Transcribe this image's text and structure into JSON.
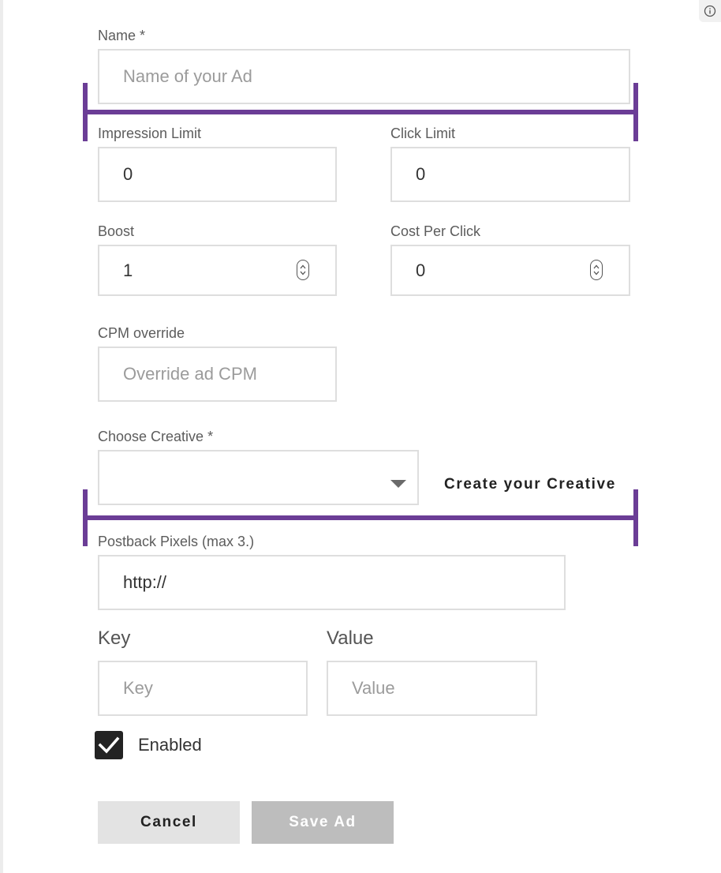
{
  "form": {
    "name": {
      "label": "Name *",
      "placeholder": "Name of your Ad",
      "value": ""
    },
    "impression_limit": {
      "label": "Impression Limit",
      "value": "0"
    },
    "click_limit": {
      "label": "Click Limit",
      "value": "0"
    },
    "boost": {
      "label": "Boost",
      "value": "1"
    },
    "cost_per_click": {
      "label": "Cost Per Click",
      "value": "0"
    },
    "cpm_override": {
      "label": "CPM override",
      "placeholder": "Override ad CPM",
      "value": ""
    },
    "creative": {
      "label": "Choose Creative *",
      "selected": "",
      "create_link": "Create your Creative"
    },
    "postback": {
      "label": "Postback Pixels (max 3.)",
      "value": "http://"
    },
    "key": {
      "label": "Key",
      "placeholder": "Key"
    },
    "value": {
      "label": "Value",
      "placeholder": "Value"
    },
    "enabled": {
      "label": "Enabled",
      "checked": true
    }
  },
  "actions": {
    "cancel": "Cancel",
    "save": "Save Ad"
  },
  "icons": {
    "info": "info-icon",
    "spinner": "spinner-arrows-icon",
    "dropdown": "chevron-down-icon",
    "check": "checkmark-icon"
  },
  "colors": {
    "accent_bracket": "#6b3d96",
    "field_border": "#dedede",
    "checkbox_fill": "#232323",
    "cancel_bg": "#e3e3e3",
    "save_bg_disabled": "#bdbdbd"
  }
}
